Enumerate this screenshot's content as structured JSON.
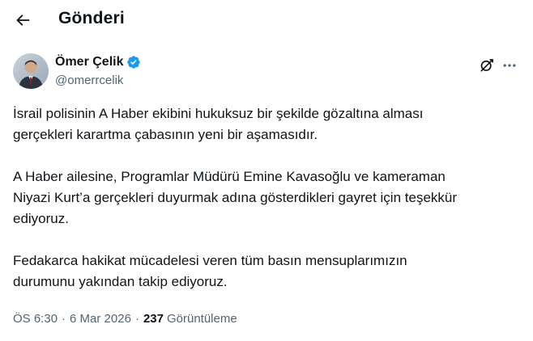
{
  "header": {
    "title": "Gönderi"
  },
  "tweet": {
    "author": {
      "name": "Ömer Çelik",
      "handle": "@omerrcelik",
      "verified": true
    },
    "paragraphs": [
      "İsrail polisinin A Haber ekibini hukuksuz bir şekilde gözaltına alması\ngerçekleri karartma çabasının yeni bir aşamasıdır.",
      "A Haber ailesine, Programlar Müdürü Emine Kavasoğlu ve kameraman\nNiyazi Kurt’a gerçekleri duyurmak adına gösterdikleri gayret için teşekkür\nediyoruz.",
      "Fedakarca hakikat mücadelesi veren tüm basın mensuplarımızın\ndurumunu yakından takip ediyoruz."
    ],
    "time": "ÖS 6:30",
    "date": "6 Mar 2026",
    "separator": "·",
    "views_count": "237",
    "views_label": "Görüntüleme"
  },
  "colors": {
    "text": "#0f1419",
    "secondary": "#536471",
    "verified": "#1d9bf0"
  },
  "icons": {
    "back": "arrow-left-icon",
    "verified": "verified-badge-icon",
    "grok": "grok-icon",
    "more": "more-icon"
  }
}
